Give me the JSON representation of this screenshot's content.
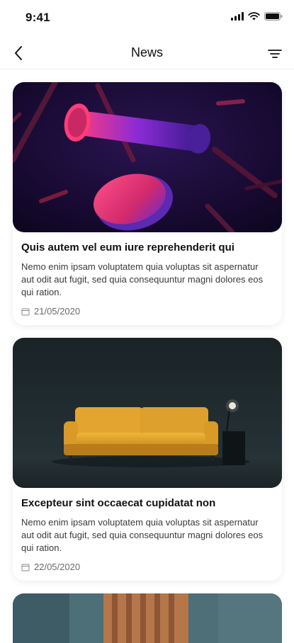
{
  "status_bar": {
    "time": "9:41",
    "icons": [
      "signal-icon",
      "wifi-icon",
      "battery-icon"
    ]
  },
  "nav": {
    "title": "News",
    "back_icon": "chevron-left-icon",
    "filter_icon": "filter-icon"
  },
  "articles": [
    {
      "title": "Quis autem vel eum iure reprehenderit qui",
      "description": "Nemo enim ipsam voluptatem quia voluptas sit aspernatur aut odit aut fugit, sed quia consequuntur magni dolores eos qui ration.",
      "date": "21/05/2020",
      "image": "abstract-3d-shapes-image"
    },
    {
      "title": "Excepteur sint occaecat cupidatat non",
      "description": "Nemo enim ipsam voluptatem quia voluptas sit aspernatur aut odit aut fugit, sed quia consequuntur magni dolores eos qui ration.",
      "date": "22/05/2020",
      "image": "yellow-sofa-image"
    },
    {
      "image": "interior-wall-image"
    }
  ],
  "colors": {
    "accent_pink": "#e6307a",
    "accent_purple": "#5a1fb0",
    "sofa_yellow": "#e2a430",
    "room_dark": "#1f2a2e"
  }
}
